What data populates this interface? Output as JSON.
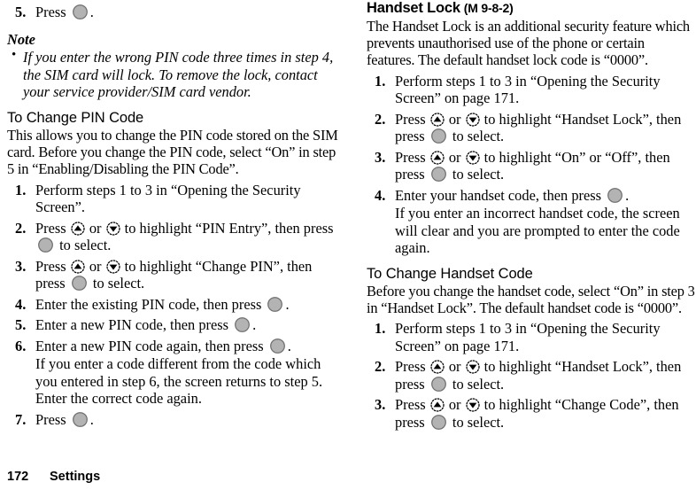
{
  "page": {
    "number": "172",
    "section": "Settings"
  },
  "icons": {
    "up": "nav-up-key-icon",
    "down": "nav-down-key-icon",
    "select": "center-select-key-icon"
  },
  "colors": {
    "text": "#000000",
    "select_key_fill": "#b3b3b3",
    "select_key_stroke": "#6e6e6e"
  },
  "left_column": {
    "step5": {
      "num": "5.",
      "text_before": "Press",
      "text_after": "."
    },
    "note": {
      "title": "Note",
      "bullet": "•",
      "items": [
        "If you enter the wrong PIN code three times in step 4, the SIM card will lock. To remove the lock, contact your service provider/SIM card vendor."
      ]
    },
    "change_pin": {
      "heading": "To Change PIN Code",
      "intro": "This allows you to change the PIN code stored on the SIM card. Before you change the PIN code, select “On” in step 5 in “Enabling/Disabling the PIN Code”.",
      "steps": [
        {
          "num": "1.",
          "parts": [
            {
              "type": "text",
              "value": "Perform steps 1 to 3 in “Opening the Security Screen”."
            }
          ]
        },
        {
          "num": "2.",
          "parts": [
            {
              "type": "text",
              "value": "Press "
            },
            {
              "type": "icon",
              "value": "up"
            },
            {
              "type": "text",
              "value": " or "
            },
            {
              "type": "icon",
              "value": "down"
            },
            {
              "type": "text",
              "value": " to highlight “PIN Entry”, then press "
            },
            {
              "type": "icon",
              "value": "select"
            },
            {
              "type": "text",
              "value": " to select."
            }
          ]
        },
        {
          "num": "3.",
          "parts": [
            {
              "type": "text",
              "value": "Press "
            },
            {
              "type": "icon",
              "value": "up"
            },
            {
              "type": "text",
              "value": " or "
            },
            {
              "type": "icon",
              "value": "down"
            },
            {
              "type": "text",
              "value": " to highlight “Change PIN”, then press "
            },
            {
              "type": "icon",
              "value": "select"
            },
            {
              "type": "text",
              "value": " to select."
            }
          ]
        },
        {
          "num": "4.",
          "parts": [
            {
              "type": "text",
              "value": "Enter the existing PIN code, then press "
            },
            {
              "type": "icon",
              "value": "select"
            },
            {
              "type": "text",
              "value": "."
            }
          ]
        },
        {
          "num": "5.",
          "parts": [
            {
              "type": "text",
              "value": "Enter a new PIN code, then press "
            },
            {
              "type": "icon",
              "value": "select"
            },
            {
              "type": "text",
              "value": "."
            }
          ]
        },
        {
          "num": "6.",
          "parts": [
            {
              "type": "text",
              "value": "Enter a new PIN code again, then press "
            },
            {
              "type": "icon",
              "value": "select"
            },
            {
              "type": "text",
              "value": "."
            }
          ],
          "follow_up": "If you enter a code different from the code which you entered in step 6, the screen returns to step 5. Enter the correct code again."
        },
        {
          "num": "7.",
          "parts": [
            {
              "type": "text",
              "value": "Press "
            },
            {
              "type": "icon",
              "value": "select"
            },
            {
              "type": "text",
              "value": "."
            }
          ]
        }
      ]
    }
  },
  "right_column": {
    "handset_lock": {
      "heading": "Handset Lock",
      "menu_ref": "(M 9-8-2)",
      "intro": "The Handset Lock is an additional security feature which prevents unauthorised use of the phone or certain features. The default handset lock code is “0000”.",
      "steps": [
        {
          "num": "1.",
          "parts": [
            {
              "type": "text",
              "value": "Perform steps 1 to 3 in “Opening the Security Screen” on page 171."
            }
          ]
        },
        {
          "num": "2.",
          "parts": [
            {
              "type": "text",
              "value": "Press "
            },
            {
              "type": "icon",
              "value": "up"
            },
            {
              "type": "text",
              "value": " or "
            },
            {
              "type": "icon",
              "value": "down"
            },
            {
              "type": "text",
              "value": " to highlight “Handset Lock”, then press "
            },
            {
              "type": "icon",
              "value": "select"
            },
            {
              "type": "text",
              "value": " to select."
            }
          ]
        },
        {
          "num": "3.",
          "parts": [
            {
              "type": "text",
              "value": "Press "
            },
            {
              "type": "icon",
              "value": "up"
            },
            {
              "type": "text",
              "value": " or "
            },
            {
              "type": "icon",
              "value": "down"
            },
            {
              "type": "text",
              "value": " to highlight “On” or “Off”, then press "
            },
            {
              "type": "icon",
              "value": "select"
            },
            {
              "type": "text",
              "value": " to select."
            }
          ]
        },
        {
          "num": "4.",
          "parts": [
            {
              "type": "text",
              "value": "Enter your handset code, then press "
            },
            {
              "type": "icon",
              "value": "select"
            },
            {
              "type": "text",
              "value": "."
            }
          ],
          "follow_up": "If you enter an incorrect handset code, the screen will clear and you are prompted to enter the code again."
        }
      ]
    },
    "change_handset_code": {
      "heading": "To Change Handset Code",
      "intro": "Before you change the handset code, select “On” in step 3 in “Handset Lock”. The default handset code is “0000”.",
      "steps": [
        {
          "num": "1.",
          "parts": [
            {
              "type": "text",
              "value": "Perform steps 1 to 3 in “Opening the Security Screen” on page 171."
            }
          ]
        },
        {
          "num": "2.",
          "parts": [
            {
              "type": "text",
              "value": "Press "
            },
            {
              "type": "icon",
              "value": "up"
            },
            {
              "type": "text",
              "value": " or "
            },
            {
              "type": "icon",
              "value": "down"
            },
            {
              "type": "text",
              "value": " to highlight “Handset Lock”, then press "
            },
            {
              "type": "icon",
              "value": "select"
            },
            {
              "type": "text",
              "value": " to select."
            }
          ]
        },
        {
          "num": "3.",
          "parts": [
            {
              "type": "text",
              "value": "Press "
            },
            {
              "type": "icon",
              "value": "up"
            },
            {
              "type": "text",
              "value": " or "
            },
            {
              "type": "icon",
              "value": "down"
            },
            {
              "type": "text",
              "value": " to highlight “Change Code”, then press "
            },
            {
              "type": "icon",
              "value": "select"
            },
            {
              "type": "text",
              "value": " to select."
            }
          ]
        }
      ]
    }
  }
}
